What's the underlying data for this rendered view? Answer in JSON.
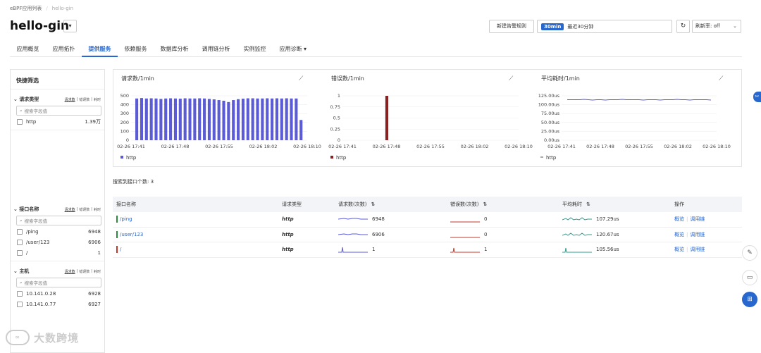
{
  "breadcrumb": {
    "root": "eBPF应用列表",
    "sep": "/",
    "current": "hello-gin"
  },
  "app_title": "hello-gin",
  "header": {
    "alert_btn": "新建告警规则",
    "time_pill": "30min",
    "time_text": "最近30分钟",
    "refresh_label": "刷新率: off"
  },
  "tabs": [
    "应用概览",
    "应用拓扑",
    "提供服务",
    "依赖服务",
    "数据库分析",
    "调用链分析",
    "实例监控",
    "应用诊断"
  ],
  "active_tab": "提供服务",
  "sidebar": {
    "title": "快捷筛选",
    "groups": [
      {
        "title": "请求类型",
        "tabs": [
          "请求数",
          "错误数",
          "耗时"
        ],
        "placeholder": "搜索字段值",
        "items": [
          {
            "label": "http",
            "value": "1.39万"
          }
        ]
      },
      {
        "title": "接口名称",
        "tabs": [
          "请求数",
          "错误数",
          "耗时"
        ],
        "placeholder": "搜索字段值",
        "items": [
          {
            "label": "/ping",
            "value": "6948"
          },
          {
            "label": "/user/123",
            "value": "6906"
          },
          {
            "label": "/",
            "value": "1"
          }
        ]
      },
      {
        "title": "主机",
        "tabs": [
          "请求数",
          "错误数",
          "耗时"
        ],
        "placeholder": "搜索字段值",
        "items": [
          {
            "label": "10.141.0.28",
            "value": "6928"
          },
          {
            "label": "10.141.0.77",
            "value": "6927"
          }
        ]
      }
    ]
  },
  "charts": [
    {
      "title": "请求数/1min",
      "legend": "http"
    },
    {
      "title": "错误数/1min",
      "legend": "http"
    },
    {
      "title": "平均耗时/1min",
      "legend": "http"
    }
  ],
  "chart_data": [
    {
      "type": "bar",
      "title": "请求数/1min",
      "color": "#5b5bd6",
      "yticks": [
        "500",
        "400",
        "300",
        "200",
        "100",
        "0"
      ],
      "ylim": [
        0,
        500
      ],
      "xticks": [
        "02-26 17:41",
        "02-26 17:48",
        "02-26 17:55",
        "02-26 18:02",
        "02-26 18:10"
      ],
      "series": [
        {
          "name": "http",
          "values": [
            470,
            475,
            470,
            472,
            470,
            465,
            470,
            472,
            470,
            468,
            472,
            470,
            470,
            472,
            470,
            465,
            460,
            452,
            445,
            430,
            452,
            462,
            468,
            472,
            472,
            470,
            470,
            472,
            470,
            472,
            470,
            472,
            470,
            470,
            228
          ]
        }
      ]
    },
    {
      "type": "bar",
      "title": "错误数/1min",
      "color": "#8b2020",
      "yticks": [
        "1",
        "0.75",
        "0.5",
        "0.25",
        "0"
      ],
      "ylim": [
        0,
        1
      ],
      "xticks": [
        "02-26 17:41",
        "02-26 17:48",
        "02-26 17:55",
        "02-26 18:02",
        "02-26 18:10"
      ],
      "series": [
        {
          "name": "http",
          "values": [
            0,
            0,
            0,
            0,
            0,
            0,
            0,
            0,
            1,
            0,
            0,
            0,
            0,
            0,
            0,
            0,
            0,
            0,
            0,
            0,
            0,
            0,
            0,
            0,
            0,
            0,
            0,
            0,
            0,
            0,
            0,
            0,
            0,
            0,
            0
          ]
        }
      ]
    },
    {
      "type": "line",
      "title": "平均耗时/1min",
      "color": "#5b5bd6",
      "yticks": [
        "125.00us",
        "100.00us",
        "75.00us",
        "50.00us",
        "25.00us",
        "0.00us"
      ],
      "ylim": [
        0,
        125
      ],
      "xticks": [
        "02-26 17:41",
        "02-26 17:48",
        "02-26 17:55",
        "02-26 18:02",
        "02-26 18:10"
      ],
      "series": [
        {
          "name": "http",
          "values": [
            114,
            114,
            114,
            114,
            115,
            114,
            113,
            114,
            114,
            113,
            114,
            114,
            114,
            115,
            114,
            114,
            114,
            114,
            113,
            114,
            114,
            114,
            113,
            114,
            114,
            114,
            115,
            114,
            114,
            113,
            114,
            114,
            114,
            114,
            113
          ]
        }
      ]
    }
  ],
  "search_stat": "搜索到接口个数: 3",
  "table": {
    "headers": [
      "接口名称",
      "请求类型",
      "请求数(次数)",
      "错误数(次数)",
      "平均耗时",
      "操作"
    ],
    "rows": [
      {
        "name": "/ping",
        "status_color": "#2e8b3e",
        "type": "http",
        "req": "6948",
        "err": "0",
        "lat": "107.29us"
      },
      {
        "name": "/user/123",
        "status_color": "#2e8b3e",
        "type": "http",
        "req": "6906",
        "err": "0",
        "lat": "120.67us"
      },
      {
        "name": "/",
        "status_color": "#c0392b",
        "type": "http",
        "req": "1",
        "err": "1",
        "lat": "105.56us"
      }
    ],
    "op_overview": "概览",
    "op_trace": "调用链"
  },
  "watermark": "大数跨境"
}
